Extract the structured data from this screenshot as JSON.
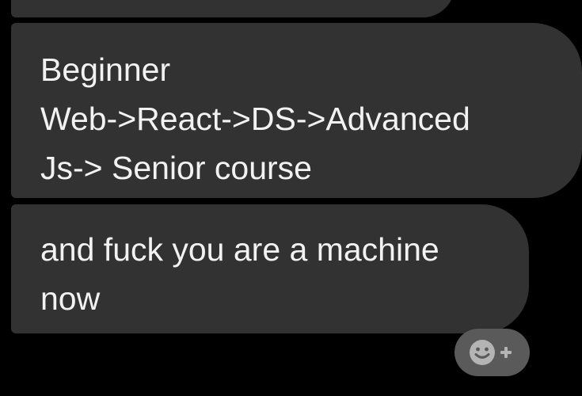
{
  "messages": [
    {
      "lines": [
        "Beginner",
        "Web->React->DS->Advanced",
        "Js-> Senior course"
      ]
    },
    {
      "lines": [
        "and fuck you are a machine",
        "now"
      ]
    }
  ],
  "reaction_button": {
    "icon": "add-reaction-icon"
  },
  "colors": {
    "background": "#000000",
    "bubble": "#323232",
    "text": "#f2f2f2",
    "reaction": "#5a5a5a"
  }
}
